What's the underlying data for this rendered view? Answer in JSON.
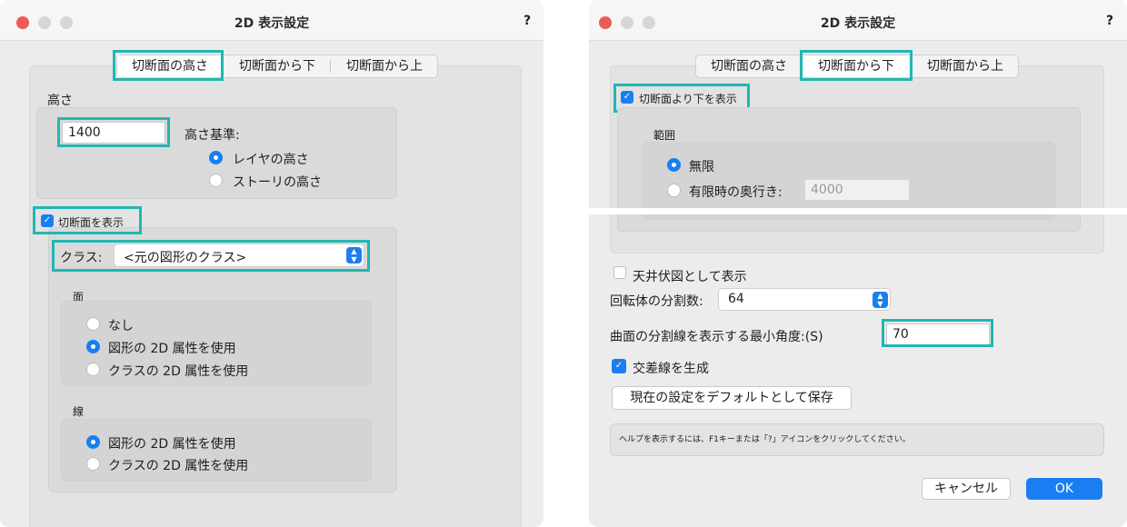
{
  "left_window": {
    "title": "2D 表示設定",
    "help": "?",
    "tabs": [
      "切断面の高さ",
      "切断面から下",
      "切断面から上"
    ],
    "height_section": {
      "label": "高さ",
      "value": "1400",
      "basis_label": "高さ基準:",
      "options": [
        "レイヤの高さ",
        "ストーリの高さ"
      ],
      "selected": "レイヤの高さ"
    },
    "show_cut_checkbox": {
      "label": "切断面を表示",
      "checked": true
    },
    "class_select": {
      "label": "クラス:",
      "value": "<元の図形のクラス>"
    },
    "face_section": {
      "label": "面",
      "options": [
        "なし",
        "図形の 2D 属性を使用",
        "クラスの 2D 属性を使用"
      ],
      "selected": "図形の 2D 属性を使用"
    },
    "line_section": {
      "label": "線",
      "options": [
        "図形の 2D 属性を使用",
        "クラスの 2D 属性を使用"
      ],
      "selected": "図形の 2D 属性を使用"
    }
  },
  "right_window": {
    "title": "2D 表示設定",
    "help": "?",
    "tabs": [
      "切断面の高さ",
      "切断面から下",
      "切断面から上"
    ],
    "active_tab": "切断面から下",
    "show_below_checkbox": {
      "label": "切断面より下を表示",
      "checked": true
    },
    "range_section": {
      "label": "範囲",
      "options": [
        "無限",
        "有限時の奥行き:"
      ],
      "selected": "無限",
      "depth_value": "4000"
    },
    "ceiling_checkbox": {
      "label": "天井伏図として表示",
      "checked": false
    },
    "rotation_select": {
      "label": "回転体の分割数:",
      "value": "64"
    },
    "min_angle": {
      "label": "曲面の分割線を表示する最小角度:(S)",
      "value": "70"
    },
    "intersection_checkbox": {
      "label": "交差線を生成",
      "checked": true
    },
    "save_default_button": "現在の設定をデフォルトとして保存",
    "help_text": "ヘルプを表示するには、F1キーまたは「?」アイコンをクリックしてください。",
    "cancel_button": "キャンセル",
    "ok_button": "OK"
  },
  "colors": {
    "highlight": "#22b6b3",
    "accent": "#1a7ef2",
    "close_dot": "#ec5b56",
    "inactive_dot": "#d6d6d6"
  }
}
